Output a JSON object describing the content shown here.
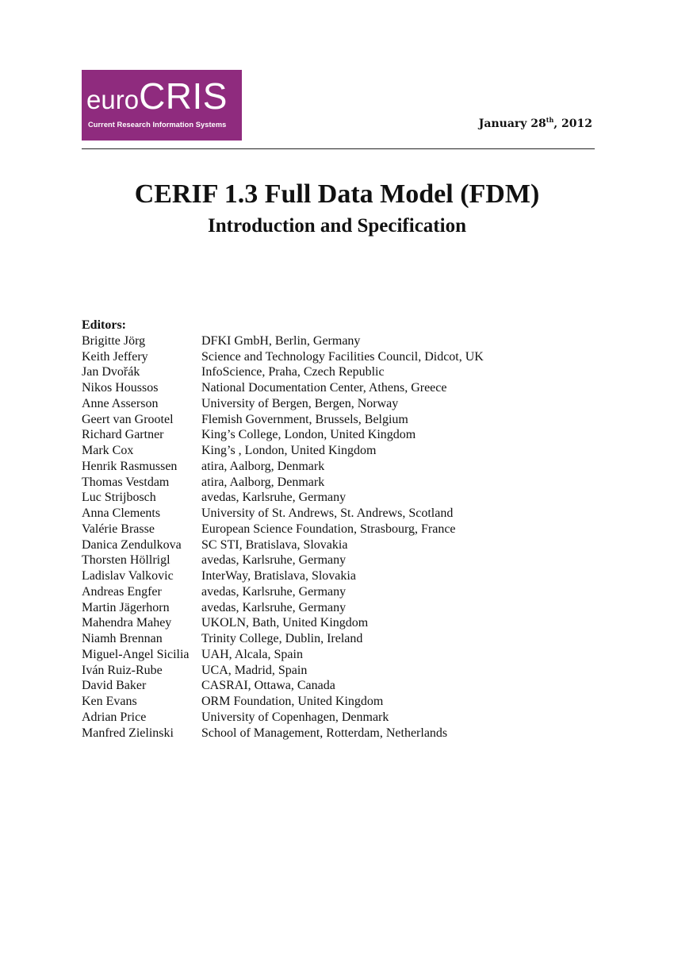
{
  "header": {
    "logo": {
      "word_prefix": "euro",
      "word_main": "CRIS",
      "tagline": "Current Research Information Systems",
      "background_color": "#8f2b7e",
      "text_color": "#ffffff"
    },
    "date": {
      "month_day": "January 28",
      "ordinal_suffix": "th",
      "year_part": ", 2012"
    }
  },
  "document": {
    "title": "CERIF 1.3 Full Data Model (FDM)",
    "subtitle": "Introduction and Specification"
  },
  "editors": {
    "heading": "Editors:",
    "list": [
      {
        "name": "Brigitte Jörg",
        "affiliation": "DFKI GmbH, Berlin, Germany"
      },
      {
        "name": "Keith Jeffery",
        "affiliation": "Science and Technology Facilities Council, Didcot, UK"
      },
      {
        "name": "Jan Dvořák",
        "affiliation": "InfoScience, Praha, Czech Republic"
      },
      {
        "name": "Nikos Houssos",
        "affiliation": "National Documentation Center, Athens, Greece"
      },
      {
        "name": "Anne Asserson",
        "affiliation": "University of Bergen, Bergen, Norway"
      },
      {
        "name": "Geert van Grootel",
        "affiliation": "Flemish Government, Brussels, Belgium"
      },
      {
        "name": "Richard Gartner",
        "affiliation": "King’s College, London, United Kingdom"
      },
      {
        "name": "Mark Cox",
        "affiliation": "King’s , London, United Kingdom"
      },
      {
        "name": "Henrik Rasmussen",
        "affiliation": "atira, Aalborg, Denmark"
      },
      {
        "name": "Thomas Vestdam",
        "affiliation": "atira, Aalborg, Denmark"
      },
      {
        "name": "Luc Strijbosch",
        "affiliation": "avedas, Karlsruhe, Germany"
      },
      {
        "name": "Anna Clements",
        "affiliation": "University of St. Andrews, St. Andrews, Scotland"
      },
      {
        "name": "Valérie Brasse",
        "affiliation": "European Science Foundation, Strasbourg, France"
      },
      {
        "name": "Danica Zendulkova",
        "affiliation": "SC STI, Bratislava, Slovakia"
      },
      {
        "name": "Thorsten Höllrigl",
        "affiliation": "avedas, Karlsruhe, Germany"
      },
      {
        "name": "Ladislav Valkovic",
        "affiliation": "InterWay, Bratislava, Slovakia"
      },
      {
        "name": "Andreas Engfer",
        "affiliation": "avedas, Karlsruhe, Germany"
      },
      {
        "name": "Martin Jägerhorn",
        "affiliation": "avedas, Karlsruhe, Germany"
      },
      {
        "name": "Mahendra Mahey",
        "affiliation": "UKOLN, Bath, United Kingdom"
      },
      {
        "name": "Niamh Brennan",
        "affiliation": "Trinity College, Dublin, Ireland"
      },
      {
        "name": "Miguel-Angel Sicilia",
        "affiliation": "UAH, Alcala, Spain"
      },
      {
        "name": "Iván Ruiz-Rube",
        "affiliation": "UCA, Madrid, Spain"
      },
      {
        "name": "David Baker",
        "affiliation": "CASRAI, Ottawa, Canada"
      },
      {
        "name": "Ken Evans",
        "affiliation": "ORM Foundation, United Kingdom"
      },
      {
        "name": "Adrian Price",
        "affiliation": "University of Copenhagen, Denmark"
      },
      {
        "name": "Manfred Zielinski",
        "affiliation": "School of Management, Rotterdam, Netherlands"
      }
    ]
  }
}
